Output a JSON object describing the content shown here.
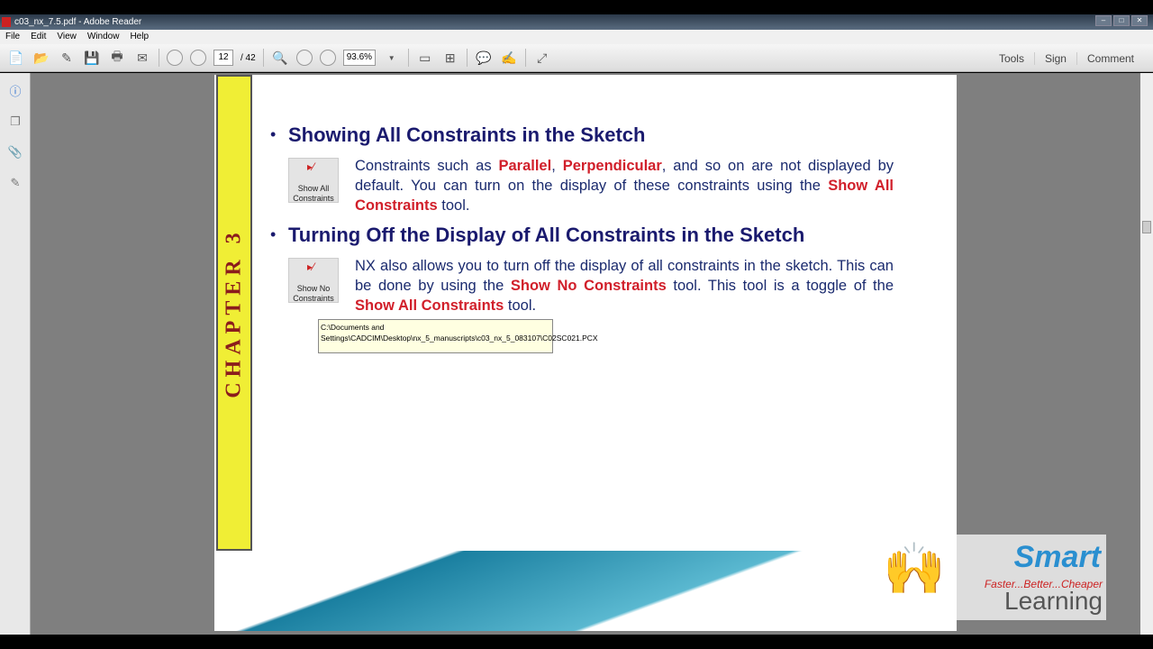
{
  "window": {
    "title": "c03_nx_7.5.pdf - Adobe Reader"
  },
  "menu": [
    "File",
    "Edit",
    "View",
    "Window",
    "Help"
  ],
  "toolbar": {
    "page_current": "12",
    "page_total": "/ 42",
    "zoom": "93.6%",
    "links": [
      "Tools",
      "Sign",
      "Comment"
    ]
  },
  "page": {
    "chapter_label": "CHAPTER 3",
    "sections": [
      {
        "heading": "Showing All Constraints in the Sketch",
        "tool_label": "Show All Constraints",
        "text_1": "Constraints such as ",
        "red_1": "Parallel",
        "text_2": ", ",
        "red_2": "Perpendicular",
        "text_3": ", and so on are not displayed by default. You can turn on the display of these constraints using the ",
        "red_3": "Show All Constraints",
        "text_4": " tool."
      },
      {
        "heading": "Turning Off the Display of All Constraints in the Sketch",
        "tool_label": "Show No Constraints",
        "text_1": "NX also allows you to turn off the display of all constraints in the sketch. This can be done by using the ",
        "red_1": "Show No Constraints",
        "text_2": " tool. This tool is a toggle of the ",
        "red_2": "Show All Constraints",
        "text_3": " tool."
      }
    ]
  },
  "tooltip": "C:\\Documents and Settings\\CADCIM\\Desktop\\nx_5_manuscripts\\c03_nx_5_083107\\C02SC021.PCX",
  "logo": {
    "brand": "Smart",
    "tagline": "Faster...Better...Cheaper",
    "sub": "Learning"
  }
}
